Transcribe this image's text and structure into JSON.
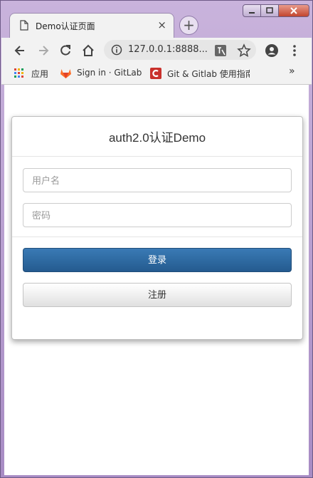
{
  "browser": {
    "tab_title": "Demo认证页面",
    "tab_close": "×",
    "new_tab": "+",
    "url": "127.0.0.1:8888...",
    "bookmarks": [
      {
        "label": "应用"
      },
      {
        "label": "Sign in · GitLab"
      },
      {
        "label": "Git & Gitlab 使用指南"
      }
    ],
    "bookmarks_overflow": "»"
  },
  "login": {
    "title": "auth2.0认证Demo",
    "username_placeholder": "用户名",
    "password_placeholder": "密码",
    "login_label": "登录",
    "register_label": "注册"
  },
  "colors": {
    "primary_button": "#2d6aa3",
    "frame": "#b9a2cf"
  }
}
